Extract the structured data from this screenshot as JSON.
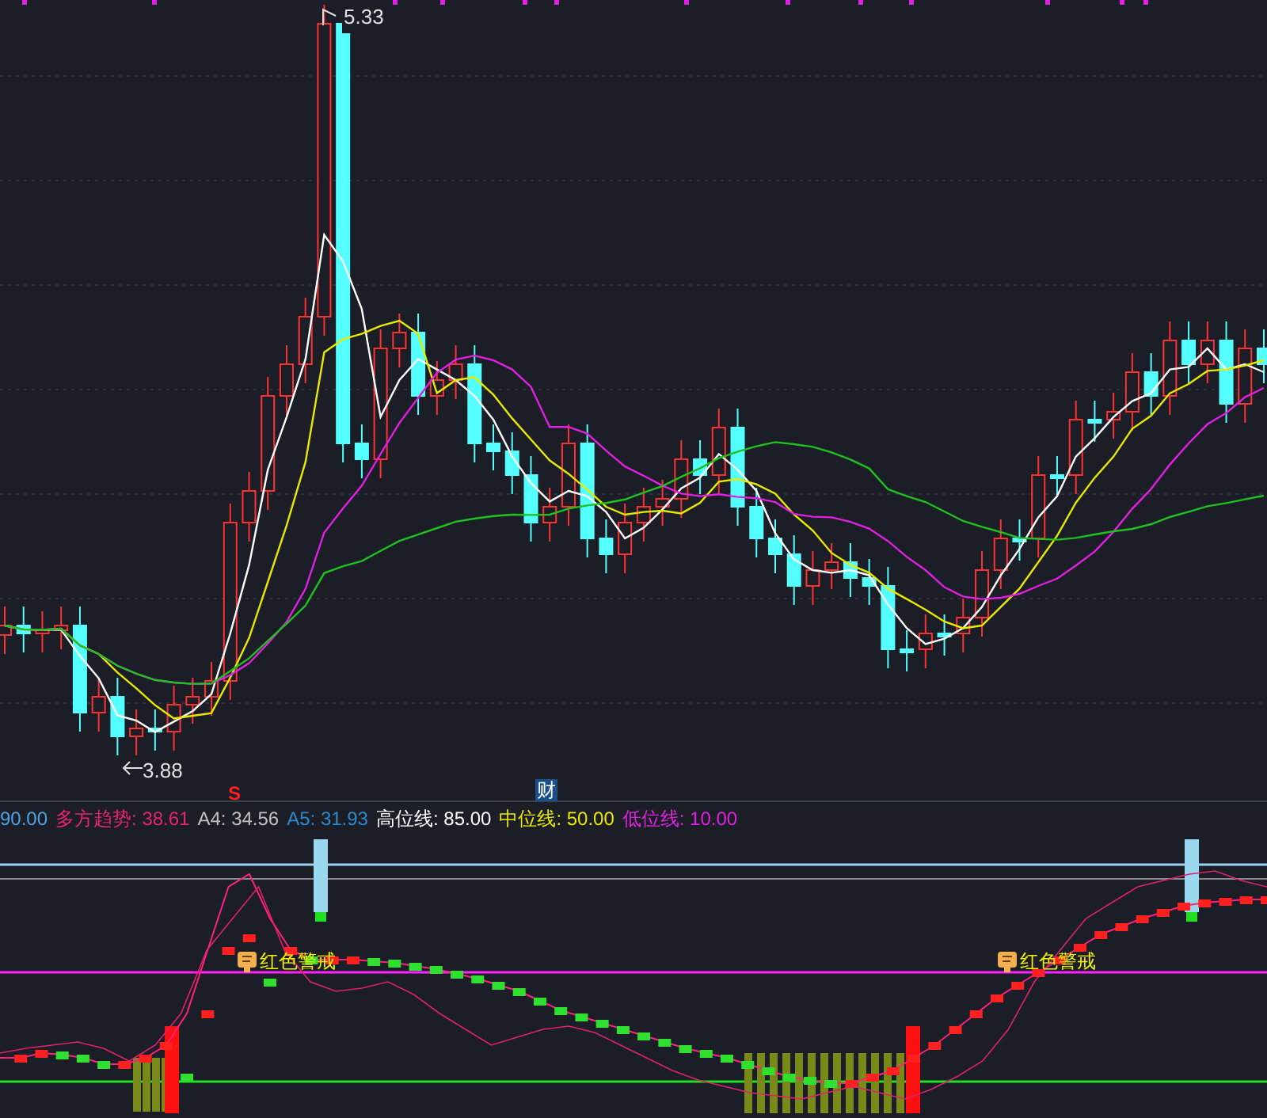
{
  "price_chart": {
    "high_label": "5.33",
    "low_label": "3.88",
    "signal_marker": "S",
    "finance_marker": "财"
  },
  "indicator_legend": [
    {
      "text": "90.00",
      "color": "#4fa3e0"
    },
    {
      "text": "多方趋势: 38.61",
      "color": "#e8246e"
    },
    {
      "text": "A4: 34.56",
      "color": "#c0c0c0"
    },
    {
      "text": "A5: 31.93",
      "color": "#2a8ad0"
    },
    {
      "text": "高位线: 85.00",
      "color": "#ffffff"
    },
    {
      "text": "中位线: 50.00",
      "color": "#e8e800"
    },
    {
      "text": "低位线: 10.00",
      "color": "#e020e0"
    }
  ],
  "indicator_panel": {
    "alerts": [
      "红色警戒",
      "红色警戒"
    ]
  }
}
